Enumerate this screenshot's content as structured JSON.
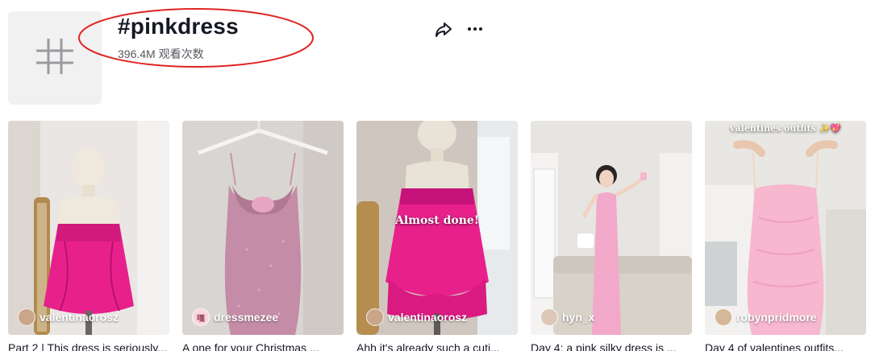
{
  "header": {
    "title": "#pinkdress",
    "views": "396.4M 观看次数",
    "hashtag_icon": "hashtag-icon",
    "share_icon": "share-icon",
    "more_icon": "more-icon",
    "highlight_color": "#e02424"
  },
  "videos": [
    {
      "author": "valentinaorosz",
      "caption": "Part 2 | This dress is seriously...",
      "overlay": "",
      "avatar_color": "#c9a58a"
    },
    {
      "author": "dressmezee",
      "caption": "A one for your Christmas ...",
      "overlay": "",
      "avatar_text": "嘿",
      "avatar_color": "#f7d7de"
    },
    {
      "author": "valentinaorosz",
      "caption": "Ahh it's already such a cuti...",
      "overlay": "Almost done!",
      "avatar_color": "#c9a58a"
    },
    {
      "author": "hyn_x",
      "caption": "Day 4: a pink silky dress is ...",
      "overlay": "",
      "avatar_color": "#dcc7b8"
    },
    {
      "author": "robynpridmore",
      "caption": "Day 4 of valentines outfits...",
      "overlay": "valentines outfits ✨💖",
      "avatar_color": "#d6b79a"
    }
  ],
  "colors": {
    "accent_pink": "#e8208c",
    "light_pink": "#f2a9c9",
    "sparkle_pink": "#b98aa0"
  }
}
